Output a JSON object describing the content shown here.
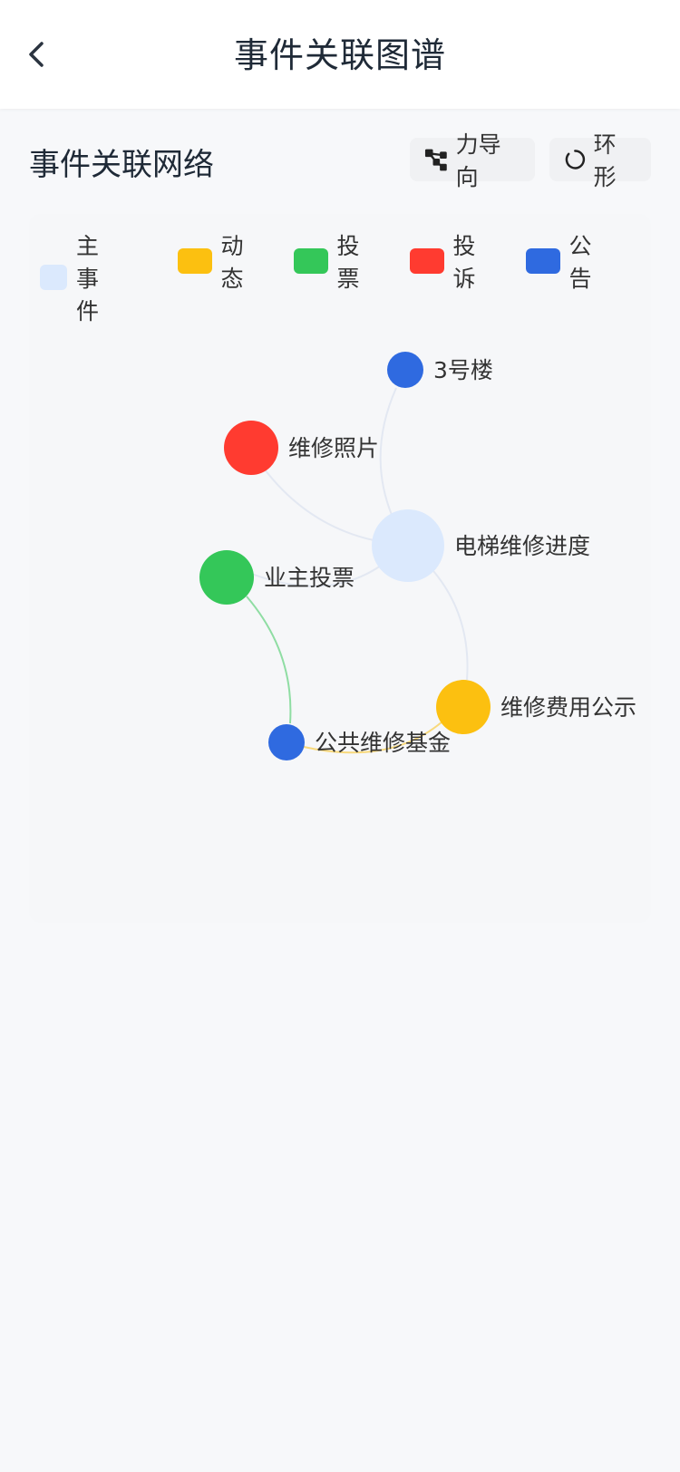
{
  "header": {
    "title": "事件关联图谱"
  },
  "section": {
    "title": "事件关联网络"
  },
  "layout_buttons": [
    {
      "label": "力导向",
      "icon": "network-icon"
    },
    {
      "label": "环形",
      "icon": "ring-icon"
    }
  ],
  "legend": [
    {
      "label": "主事件",
      "color": "#dbe9fd"
    },
    {
      "label": "动态",
      "color": "#fcc010"
    },
    {
      "label": "投票",
      "color": "#34c759"
    },
    {
      "label": "投诉",
      "color": "#ff3b30"
    },
    {
      "label": "公告",
      "color": "#2f6ae0"
    }
  ],
  "graph": {
    "nodes": [
      {
        "id": "main",
        "label": "电梯维修进度",
        "category": "主事件"
      },
      {
        "id": "b3",
        "label": "3号楼",
        "category": "公告"
      },
      {
        "id": "photo",
        "label": "维修照片",
        "category": "投诉"
      },
      {
        "id": "vote",
        "label": "业主投票",
        "category": "投票"
      },
      {
        "id": "fee",
        "label": "维修费用公示",
        "category": "动态"
      },
      {
        "id": "fund",
        "label": "公共维修基金",
        "category": "公告"
      }
    ],
    "edges": [
      {
        "source": "main",
        "target": "b3"
      },
      {
        "source": "main",
        "target": "photo"
      },
      {
        "source": "main",
        "target": "vote"
      },
      {
        "source": "main",
        "target": "fee"
      },
      {
        "source": "vote",
        "target": "fund"
      },
      {
        "source": "fee",
        "target": "fund"
      }
    ]
  }
}
